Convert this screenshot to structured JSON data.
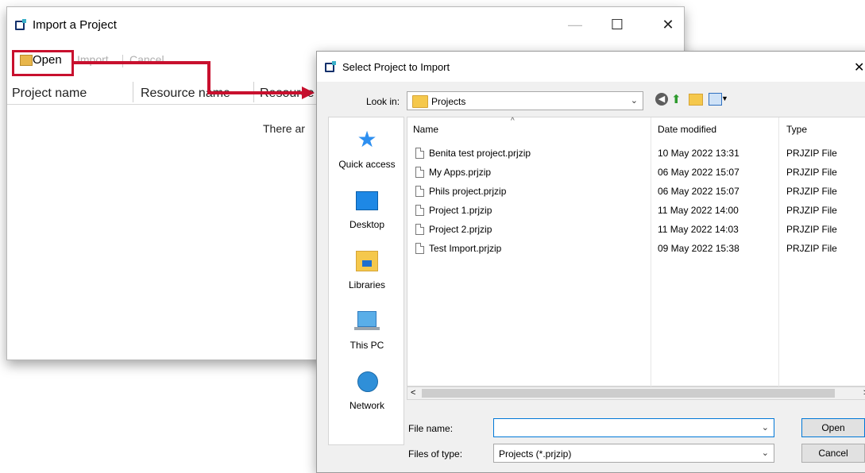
{
  "import_window": {
    "title": "Import a Project",
    "toolbar": {
      "open_label": "Open",
      "import_label": "Import",
      "cancel_label": "Cancel"
    },
    "columns": [
      "Project name",
      "Resource name",
      "Resource"
    ],
    "empty_text": "There ar",
    "controls": {
      "minimize": "—",
      "maximize": "☐",
      "close": "✕"
    }
  },
  "dialog": {
    "title": "Select Project to Import",
    "close_glyph": "✕",
    "look_in_label": "Look in:",
    "look_in_value": "Projects",
    "places": [
      {
        "label": "Quick access",
        "icon": "star-icon"
      },
      {
        "label": "Desktop",
        "icon": "desktop-icon"
      },
      {
        "label": "Libraries",
        "icon": "libraries-icon"
      },
      {
        "label": "This PC",
        "icon": "computer-icon"
      },
      {
        "label": "Network",
        "icon": "network-icon"
      }
    ],
    "columns": {
      "name": "Name",
      "date": "Date modified",
      "type": "Type"
    },
    "files": [
      {
        "name": "Benita test project.prjzip",
        "date": "10 May 2022 13:31",
        "type": "PRJZIP File"
      },
      {
        "name": "My Apps.prjzip",
        "date": "06 May 2022 15:07",
        "type": "PRJZIP File"
      },
      {
        "name": "Phils project.prjzip",
        "date": "06 May 2022 15:07",
        "type": "PRJZIP File"
      },
      {
        "name": "Project 1.prjzip",
        "date": "11 May 2022 14:00",
        "type": "PRJZIP File"
      },
      {
        "name": "Project 2.prjzip",
        "date": "11 May 2022 14:03",
        "type": "PRJZIP File"
      },
      {
        "name": "Test Import.prjzip",
        "date": "09 May 2022 15:38",
        "type": "PRJZIP File"
      }
    ],
    "file_name_label": "File name:",
    "file_name_value": "",
    "files_of_type_label": "Files of type:",
    "files_of_type_value": "Projects (*.prjzip)",
    "open_button": "Open",
    "cancel_button": "Cancel"
  },
  "colors": {
    "annotation": "#c8102e",
    "selection": "#0078d7"
  }
}
